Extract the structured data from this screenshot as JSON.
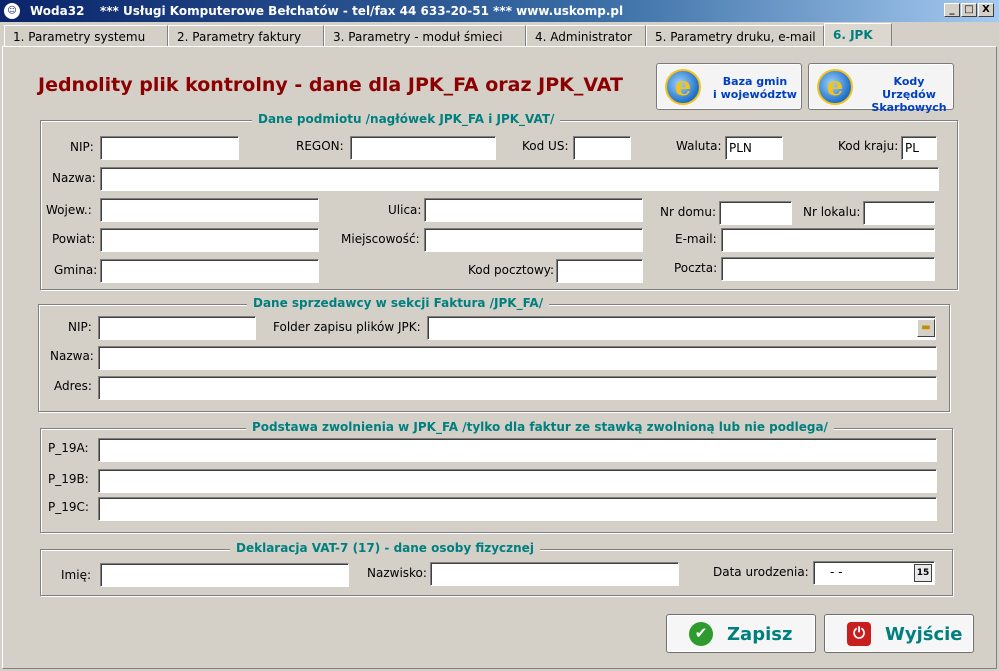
{
  "window": {
    "app_icon": "app-globe-icon",
    "app_name": "Woda32",
    "info": "*** Usługi Komputerowe Bełchatów - tel/fax  44 633-20-51  ***  www.uskomp.pl",
    "minimize": "_",
    "maximize": "□",
    "close": "X"
  },
  "tabs": [
    {
      "label": "1. Parametry systemu"
    },
    {
      "label": "2. Parametry faktury"
    },
    {
      "label": "3. Parametry - moduł śmieci"
    },
    {
      "label": "4. Administrator"
    },
    {
      "label": "5. Parametry druku, e-mail"
    },
    {
      "label": "6. JPK",
      "active": true
    }
  ],
  "page_title": "Jednolity plik kontrolny - dane dla JPK_FA oraz JPK_VAT",
  "top_buttons": {
    "gminy": {
      "line1": "Baza gmin",
      "line2": "i województw",
      "icon": "internet-explorer-icon"
    },
    "urzedy": {
      "line1": "Kody Urzędów",
      "line2": "Skarbowych",
      "icon": "internet-explorer-icon"
    }
  },
  "podmiot": {
    "legend": "Dane podmiotu /nagłówek JPK_FA i JPK_VAT/",
    "nip_label": "NIP:",
    "nip_value": "",
    "regon_label": "REGON:",
    "regon_value": "",
    "kodus_label": "Kod US:",
    "kodus_value": "",
    "waluta_label": "Waluta:",
    "waluta_value": "PLN",
    "kodkraju_label": "Kod kraju:",
    "kodkraju_value": "PL",
    "nazwa_label": "Nazwa:",
    "nazwa_value": "",
    "wojew_label": "Wojew.:",
    "wojew_value": "",
    "ulica_label": "Ulica:",
    "ulica_value": "",
    "nrdomu_label": "Nr domu:",
    "nrdomu_value": "",
    "nrlokalu_label": "Nr lokalu:",
    "nrlokalu_value": "",
    "powiat_label": "Powiat:",
    "powiat_value": "",
    "miejsc_label": "Miejscowość:",
    "miejsc_value": "",
    "email_label": "E-mail:",
    "email_value": "",
    "gmina_label": "Gmina:",
    "gmina_value": "",
    "kodpoczt_label": "Kod pocztowy:",
    "kodpoczt_value": "",
    "poczta_label": "Poczta:",
    "poczta_value": ""
  },
  "sprzedawca": {
    "legend": "Dane sprzedawcy w sekcji Faktura /JPK_FA/",
    "nip_label": "NIP:",
    "nip_value": "",
    "folder_label": "Folder zapisu plików JPK:",
    "folder_value": "",
    "folder_icon": "folder-icon",
    "nazwa_label": "Nazwa:",
    "nazwa_value": "",
    "adres_label": "Adres:",
    "adres_value": ""
  },
  "zwolnienie": {
    "legend": "Podstawa zwolnienia w JPK_FA /tylko dla faktur ze stawką zwolnioną lub nie podlega/",
    "p19a_label": "P_19A:",
    "p19a_value": "",
    "p19b_label": "P_19B:",
    "p19b_value": "",
    "p19c_label": "P_19C:",
    "p19c_value": ""
  },
  "vat7": {
    "legend": "Deklaracja VAT-7 (17) - dane osoby fizycznej",
    "imie_label": "Imię:",
    "imie_value": "",
    "nazwisko_label": "Nazwisko:",
    "nazwisko_value": "",
    "data_label": "Data urodzenia:",
    "data_value": "-  -",
    "calendar_icon": "calendar-icon",
    "calendar_glyph": "15"
  },
  "actions": {
    "zapisz": {
      "label": "Zapisz",
      "icon": "checkmark-icon",
      "glyph": "✔"
    },
    "wyjscie": {
      "label": "Wyjście",
      "icon": "power-icon",
      "glyph": "⏻"
    }
  }
}
